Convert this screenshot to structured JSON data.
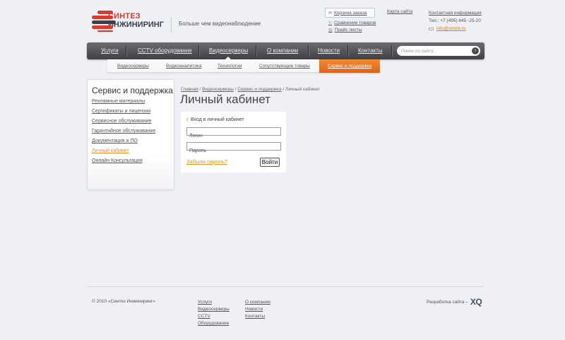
{
  "logo": {
    "line1": "СИНТЕЗ",
    "line2": "ИНЖИНИРИНГ",
    "tagline": "Больше чем видеонаблюдение"
  },
  "header": {
    "cart": "Корзина заказа",
    "compare": "Сравнение товаров",
    "pricelists": "Прайс листы",
    "sitemap": "Карта сайта",
    "contact_title": "Контактная информация",
    "phone": "Тел.: +7 (495) 645 -25-20",
    "email": "info@sintze.ru"
  },
  "nav": {
    "items": [
      {
        "label": "Услуги"
      },
      {
        "label": "CCTV оборудование"
      },
      {
        "label": "Видеосерверы"
      },
      {
        "label": "О компании"
      },
      {
        "label": "Новости"
      },
      {
        "label": "Контакты"
      }
    ],
    "search_placeholder": "Поиск по сайту..."
  },
  "subnav": {
    "items": [
      {
        "label": "Видеосерверы"
      },
      {
        "label": "Видеоаналитика"
      },
      {
        "label": "Технологии"
      },
      {
        "label": "Сопутствующие товары"
      }
    ],
    "active": "Сервис и поддержка"
  },
  "sidebar": {
    "title": "Сервис и поддержка",
    "items": [
      {
        "label": "Рекламные материалы"
      },
      {
        "label": "Сертификаты и лицензии"
      },
      {
        "label": "Сервисное обслуживание"
      },
      {
        "label": "Гарантийное обслуживание"
      },
      {
        "label": "Документация и ПО"
      },
      {
        "label": "Личный кабинет"
      },
      {
        "label": "Онлайн Консультация"
      }
    ]
  },
  "breadcrumb": {
    "items": [
      "Главная",
      "Видеосерверы",
      "Сервис и поддержка"
    ],
    "sep": " / ",
    "current": "Личный кабинет"
  },
  "page": {
    "title": "Личный кабинет"
  },
  "login": {
    "heading": "Вход в личный кабинет",
    "login_placeholder": "Логин",
    "password_placeholder": "Пароль",
    "forgot": "Забыли пароль?",
    "submit": "Войти"
  },
  "footer": {
    "copyright": "© 2010 «Синтез Инжиниринг»",
    "col1": [
      "Услуги",
      "Видеосерверы",
      "CCTV",
      "Оборудование"
    ],
    "col2": [
      "О компании",
      "Новости",
      "Контакты"
    ],
    "dev_label": "Разработка сайта –",
    "dev_logo": "XQ"
  },
  "colors": {
    "accent": "#e8741f",
    "brand_red": "#d93a2b",
    "nav_bg": "#4e4f52"
  }
}
